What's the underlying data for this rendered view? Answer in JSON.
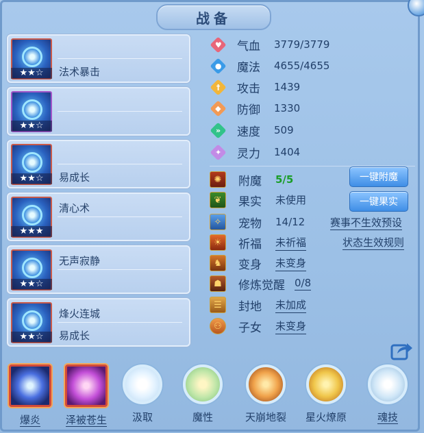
{
  "title": "战备",
  "cards": [
    {
      "stars": "★★☆",
      "line1": "",
      "line2": "法术暴击",
      "frame": "red"
    },
    {
      "stars": "★★☆",
      "line1": "",
      "line2": "",
      "frame": "purple"
    },
    {
      "stars": "★★☆",
      "line1": "",
      "line2": "易成长",
      "frame": "red"
    },
    {
      "stars": "★★★",
      "line1": "清心术",
      "line2": "",
      "frame": "red"
    },
    {
      "stars": "★★☆",
      "line1": "无声寂静",
      "line2": "",
      "frame": "red"
    },
    {
      "stars": "★★☆",
      "line1": "烽火连城",
      "line2": "易成长",
      "frame": "red"
    }
  ],
  "attributes": [
    {
      "icon": "heart-icon",
      "color": "#e8667a",
      "label": "气血",
      "value": "3779/3779"
    },
    {
      "icon": "mana-icon",
      "color": "#3a9be8",
      "label": "魔法",
      "value": "4655/4655"
    },
    {
      "icon": "sword-icon",
      "color": "#f2b63a",
      "label": "攻击",
      "value": "1439"
    },
    {
      "icon": "shield-icon",
      "color": "#f29a55",
      "label": "防御",
      "value": "1330"
    },
    {
      "icon": "speed-icon",
      "color": "#32c38a",
      "label": "速度",
      "value": "509"
    },
    {
      "icon": "spirit-icon",
      "color": "#c28be6",
      "label": "灵力",
      "value": "1404"
    }
  ],
  "info": [
    {
      "icon": "enchant-icon",
      "label": "附魔",
      "value": "5/5",
      "style": "green"
    },
    {
      "icon": "fruit-icon",
      "label": "果实",
      "value": "未使用",
      "style": "plain"
    },
    {
      "icon": "pet-icon",
      "label": "宠物",
      "value": "14/12",
      "style": "plain"
    },
    {
      "icon": "blessing-icon",
      "label": "祈福",
      "value": "未祈福",
      "style": "ul"
    },
    {
      "icon": "transform-icon",
      "label": "变身",
      "value": "未变身",
      "style": "ul"
    },
    {
      "icon": "cultivation-icon",
      "label": "修炼觉醒",
      "value": "0/8",
      "style": "ul"
    },
    {
      "icon": "territory-icon",
      "label": "封地",
      "value": "未加成",
      "style": "ul"
    },
    {
      "icon": "children-icon",
      "label": "子女",
      "value": "未变身",
      "style": "ul"
    }
  ],
  "buttons": {
    "enchant": "一键附魔",
    "fruit": "一键果实"
  },
  "links": {
    "event_preset": "赛事不生效预设",
    "status_rules": "状态生效规则"
  },
  "skills": [
    {
      "label": "爆炎",
      "shape": "square",
      "color": "#4a6fe0",
      "underline": true
    },
    {
      "label": "泽被苍生",
      "shape": "square",
      "color": "#c34fd8",
      "underline": true
    },
    {
      "label": "汲取",
      "shape": "round",
      "color": "#e8f4ff",
      "underline": false
    },
    {
      "label": "魔性",
      "shape": "round",
      "color": "#bfe6a8",
      "underline": false
    },
    {
      "label": "天崩地裂",
      "shape": "round",
      "color": "#f0a24a",
      "underline": false
    },
    {
      "label": "星火燎原",
      "shape": "round",
      "color": "#f0c64a",
      "underline": false
    },
    {
      "label": "魂技",
      "shape": "round",
      "color": "#cfe6f7",
      "underline": true
    }
  ]
}
